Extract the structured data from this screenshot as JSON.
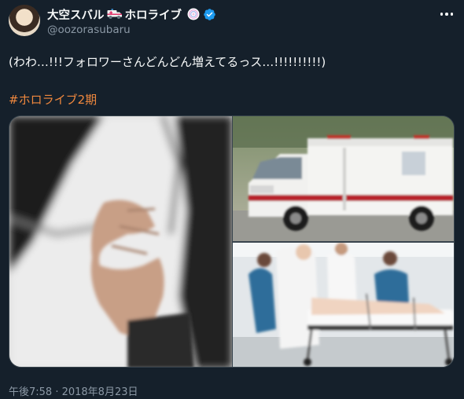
{
  "tweet": {
    "display_name": "大空スバル",
    "display_name_suffix": "ホロライブ",
    "handle": "@oozorasubaru",
    "text": "(わわ…!!!フォロワーさんどんどん増えてるっス…!!!!!!!!!!)",
    "hashtag": "#ホロライブ2期",
    "timestamp": "午後7:58 · 2018年8月23日"
  },
  "media": {
    "images": [
      {
        "name": "chest-pain-photo"
      },
      {
        "name": "ambulance-photo"
      },
      {
        "name": "hospital-stretcher-photo"
      }
    ]
  },
  "icons": {
    "name_emoji": "ambulance-icon",
    "affiliate_badge": "hololive-badge-icon",
    "verified": "verified-badge-icon",
    "more": "more-options-icon"
  },
  "colors": {
    "background": "#15202b",
    "primary_text": "#f7f9f9",
    "secondary_text": "#8b98a5",
    "hashtag": "#f0883e",
    "verified": "#1d9bf0",
    "border": "#38444d"
  }
}
